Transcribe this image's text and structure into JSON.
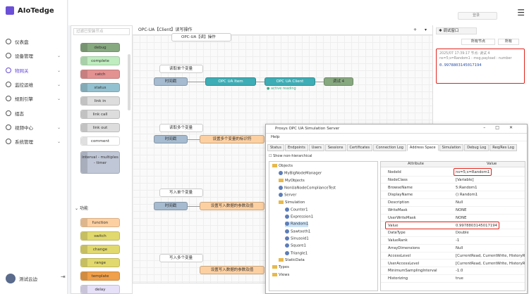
{
  "app": {
    "name": "AIoTedge",
    "top_button": "登录",
    "user": "测试云边"
  },
  "nav": [
    {
      "label": "仪表盘"
    },
    {
      "label": "设备管理"
    },
    {
      "label": "物网关",
      "active": true
    },
    {
      "label": "监控运维"
    },
    {
      "label": "规则引擎"
    },
    {
      "label": "组态"
    },
    {
      "label": "视频中心"
    },
    {
      "label": "系统管理"
    }
  ],
  "palette": {
    "search_placeholder": "过滤已安装节点",
    "section": "功能",
    "nodes": [
      {
        "label": "debug",
        "color": "#87a980"
      },
      {
        "label": "complete",
        "color": "#c0edc0"
      },
      {
        "label": "catch",
        "color": "#e49191"
      },
      {
        "label": "status",
        "color": "#94c1d0"
      },
      {
        "label": "link in",
        "color": "#dddddd"
      },
      {
        "label": "link call",
        "color": "#dddddd"
      },
      {
        "label": "link out",
        "color": "#dddddd"
      },
      {
        "label": "comment",
        "color": "#ffffff"
      },
      {
        "label": "interval - multiples - timer",
        "color": "#c0c7d6"
      },
      {
        "label": "function",
        "color": "#fdd0a2"
      },
      {
        "label": "switch",
        "color": "#e2d96e"
      },
      {
        "label": "change",
        "color": "#e2d96e"
      },
      {
        "label": "range",
        "color": "#e2d96e"
      },
      {
        "label": "template",
        "color": "#f0a04a"
      },
      {
        "label": "delay",
        "color": "#e6e0f8"
      }
    ]
  },
  "canvas": {
    "tab": "OPC-UA【Client】读写操作",
    "top_comment": "OPC-UA【读】操作",
    "comments": [
      "读取单个变量",
      "读取多个变量",
      "写入单个变量",
      "写入多个变量"
    ],
    "nodes": {
      "inject": "时间戳",
      "item": "OPC UA Item",
      "client": "OPC UA Client",
      "debug": "调试 4",
      "status": "active reading",
      "fn1": "设置多个变量的标识符",
      "fn2": "设置写入数据的参数及值",
      "fn3": "设置写入数据的参数及值"
    }
  },
  "debug": {
    "tab": "调试窗口",
    "filter": "所有节点",
    "all": "所有",
    "timestamp": "2025/07 17:39:17",
    "node": "节点: 调试 4",
    "topic": "ns=5;s=Random1 : msg.payload : number",
    "value": "0.9978803145017194"
  },
  "sim": {
    "title": "Prosys OPC UA Simulation Server",
    "menu": "Help",
    "tabs": [
      "Status",
      "Endpoints",
      "Users",
      "Sessions",
      "Certificates",
      "Connection Log",
      "Address Space",
      "Simulation",
      "Debug Log",
      "Req/Res Log"
    ],
    "show": "Show non-hierarchical",
    "tree": [
      "Objects",
      "MyBigNodeManager",
      "MyObjects",
      "NonUaNodeComplianceTest",
      "Server",
      "Simulation",
      "Counter1",
      "Expression1",
      "Random1",
      "Sawtooth1",
      "Sinusoid1",
      "Square1",
      "Triangle1",
      "StaticData",
      "Types",
      "Views"
    ],
    "attr_head": {
      "attribute": "Attribute",
      "value": "Value"
    },
    "attrs": [
      {
        "k": "NodeId",
        "v": "ns=5;s=Random1"
      },
      {
        "k": "NodeClass",
        "v": "[Variable]"
      },
      {
        "k": "BrowseName",
        "v": "5:Random1"
      },
      {
        "k": "DisplayName",
        "v": "() Random1"
      },
      {
        "k": "Description",
        "v": "Null"
      },
      {
        "k": "WriteMask",
        "v": "NONE"
      },
      {
        "k": "UserWriteMask",
        "v": "NONE"
      },
      {
        "k": "Value",
        "v": "0.9978803145017194"
      },
      {
        "k": "DataType",
        "v": "Double"
      },
      {
        "k": "ValueRank",
        "v": "-1"
      },
      {
        "k": "ArrayDimensions",
        "v": "Null"
      },
      {
        "k": "AccessLevel",
        "v": "[CurrentRead, CurrentWrite, HistoryRe..."
      },
      {
        "k": "UserAccessLevel",
        "v": "[CurrentRead, CurrentWrite, HistoryRe..."
      },
      {
        "k": "MinimumSamplingInterval",
        "v": "-1.0"
      },
      {
        "k": "Historizing",
        "v": "true"
      }
    ]
  }
}
